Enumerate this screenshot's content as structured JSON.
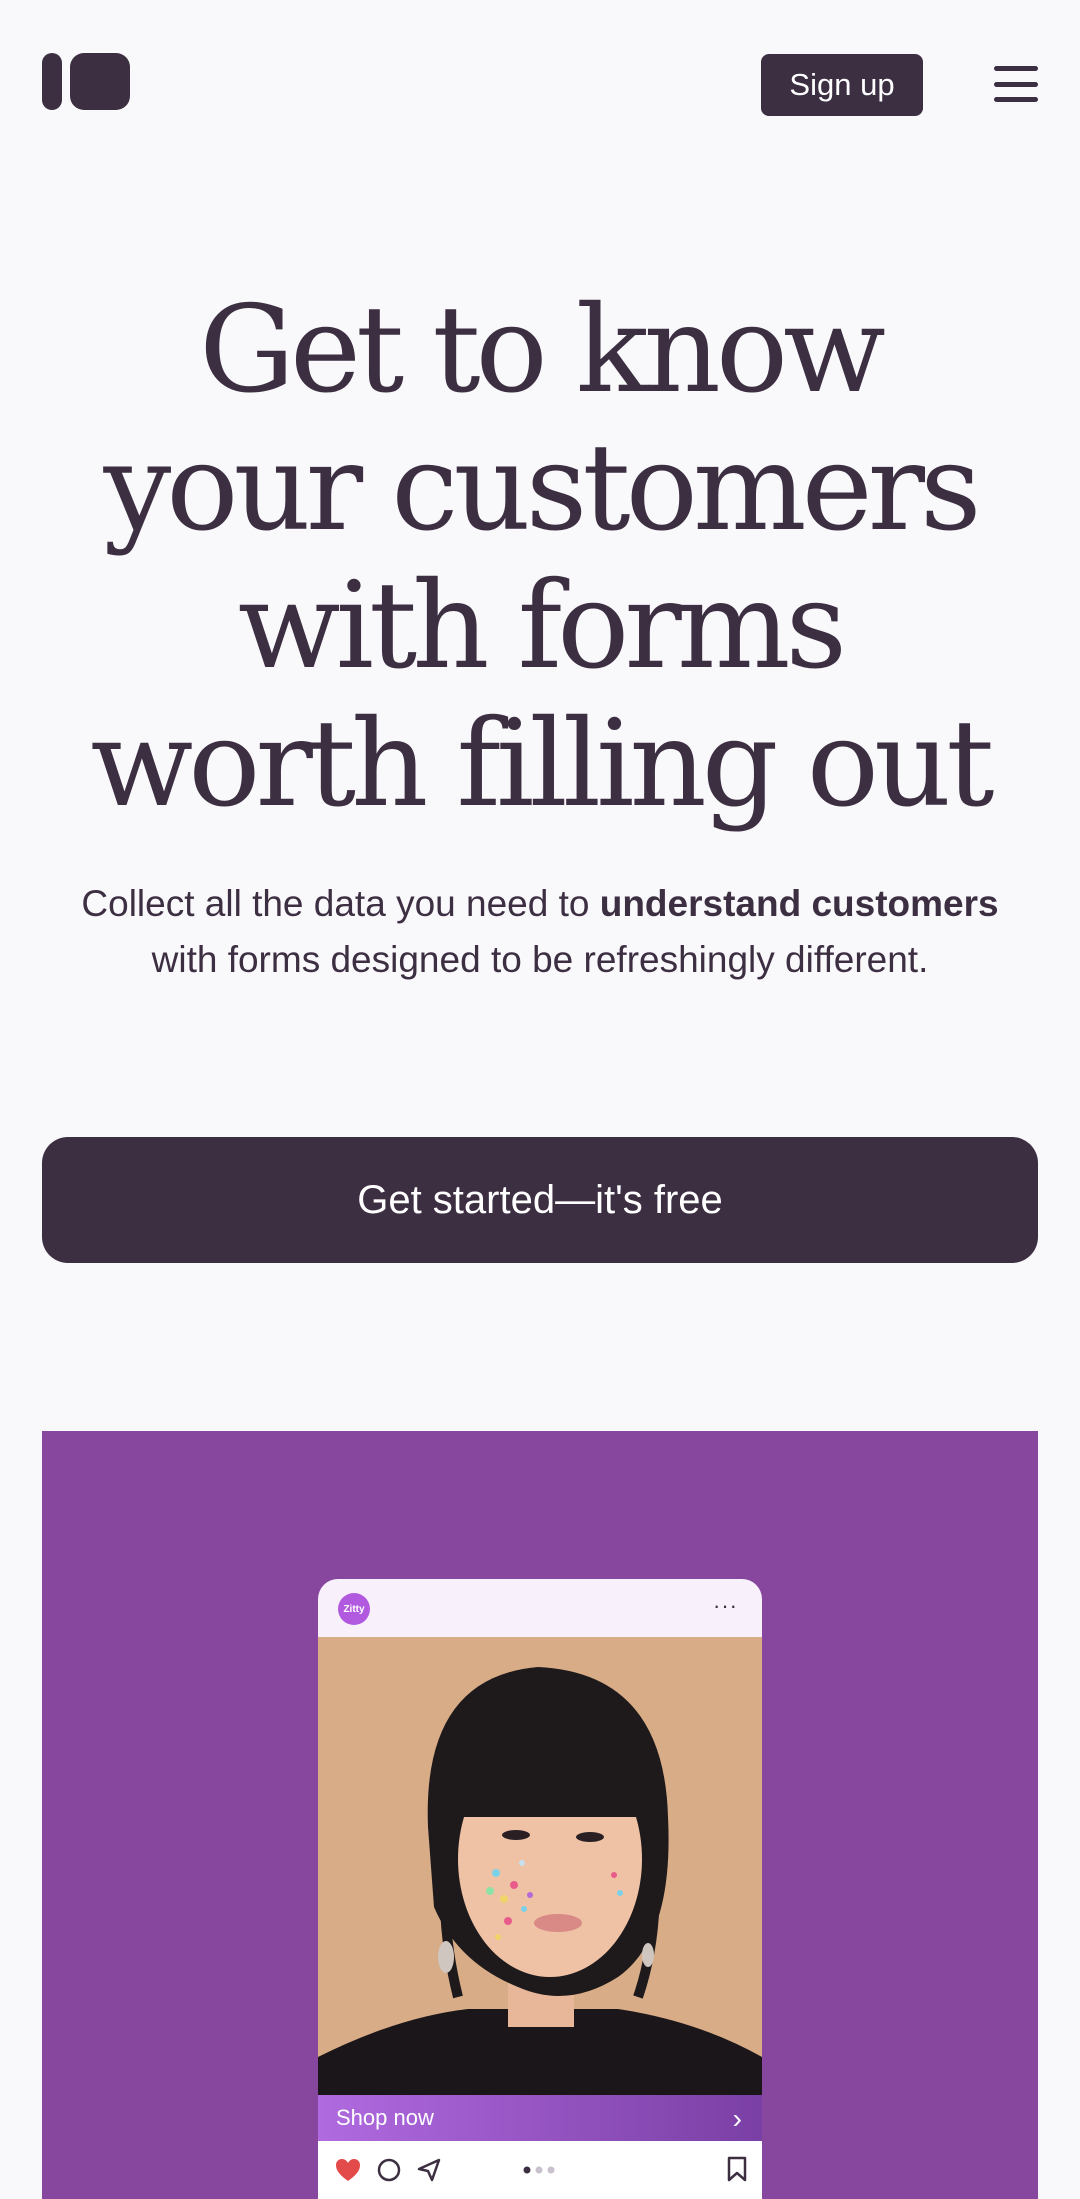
{
  "header": {
    "signup_label": "Sign up"
  },
  "hero": {
    "title_lines": [
      "Get to know",
      "your customers",
      "with forms",
      "worth filling out"
    ],
    "subtitle_before": "Collect all the data you need to ",
    "subtitle_bold": "understand customers",
    "subtitle_after": " with forms designed to be refreshingly different.",
    "cta_label": "Get started—it's free"
  },
  "showcase": {
    "background_color": "#88479e",
    "brand_badge": "Zitty",
    "more_icon": "···",
    "shop_label": "Shop now",
    "icons": [
      "heart-icon",
      "comment-icon",
      "send-icon",
      "carousel-dots",
      "bookmark-icon"
    ]
  },
  "colors": {
    "primary": "#3d2f42",
    "background": "#f9f8fb",
    "accent": "#88479e"
  }
}
